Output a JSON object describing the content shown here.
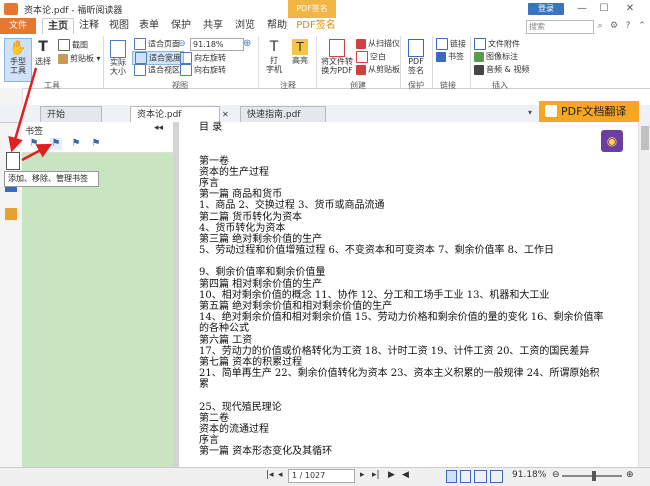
{
  "titlebar": {
    "title": "资本论.pdf - 福昕阅读器",
    "context_tab": "PDF签名",
    "login": "登录",
    "minimize": "—",
    "restore": "☐",
    "close": "✕"
  },
  "ribbon_tabs": {
    "file": "文件",
    "items": [
      "主页",
      "注释",
      "视图",
      "表单",
      "保护",
      "共享",
      "浏览",
      "帮助",
      "PDF签名"
    ]
  },
  "search": {
    "placeholder": "搜索"
  },
  "ribbon": {
    "hand_tool": "手型\n工具",
    "select": "选择",
    "screenshot": "截图",
    "clipboard": "剪贴板",
    "actual_size": "实际\n大小",
    "fit_page": "适合页面",
    "fit_width": "适合宽度",
    "fit_visible": "适合视区",
    "zoom_value": "91.18%",
    "rotate_left": "向左旋转",
    "rotate_right": "向右旋转",
    "typewriter": "打\n字机",
    "highlight": "高亮",
    "convert": "将文件转\n换为PDF",
    "from_scanner": "从扫描仪",
    "blank": "空白",
    "from_clipboard": "从剪贴板",
    "pdf_sign": "PDF\n签名",
    "link": "链接",
    "bookmark": "书签",
    "file_attachment": "文件附件",
    "image_annot": "图像标注",
    "audio_video": "音频 & 视频",
    "groups": {
      "tools": "工具",
      "view": "视图",
      "comment": "注释",
      "create": "创建",
      "protect": "保护",
      "links": "链接",
      "insert": "插入"
    }
  },
  "doc_tabs": [
    "开始",
    "资本论.pdf",
    "快速指南.pdf"
  ],
  "translate_button": "PDF文档翻译",
  "bookmark_panel": {
    "title": "书签",
    "tooltip": "添加、移除、管理书签"
  },
  "document_lines": [
    "目 录",
    "",
    "",
    "第一卷",
    "资本的生产过程",
    "序言",
    "第一篇 商品和货币",
    "1、商品 2、交换过程 3、货币或商品流通",
    "第二篇 货币转化为资本",
    "4、货币转化为资本",
    "第三篇 绝对剩余价值的生产",
    "5、劳动过程和价值增殖过程 6、不变资本和可变资本 7、剩余价值率 8、工作日",
    "",
    "9、剩余价值率和剩余价值量",
    "第四篇 相对剩余价值的生产",
    "10、相对剩余价值的概念 11、协作 12、分工和工场手工业 13、机器和大工业",
    "第五篇 绝对剩余价值和相对剩余价值的生产",
    "14、绝对剩余价值和相对剩余价值 15、劳动力价格和剩余价值的量的变化 16、剩余价值率",
    "的各种公式",
    "第六篇 工资",
    "17、劳动力的价值或价格转化为工资 18、计时工资 19、计件工资 20、工资的国民差异",
    "第七篇 资本的积累过程",
    "21、简单再生产 22、剩余价值转化为资本 23、资本主义积累的一般规律 24、所谓原始积",
    "累",
    "",
    "25、现代殖民理论",
    "第二卷",
    "资本的流通过程",
    "序言",
    "第一篇 资本形态变化及其循环"
  ],
  "status": {
    "page": "1 / 1027",
    "zoom": "91.18%"
  },
  "colors": {
    "file_tab": "#e8772e",
    "panel": "#c9e4c0",
    "translate": "#f5a623",
    "arrow": "#e02020"
  }
}
